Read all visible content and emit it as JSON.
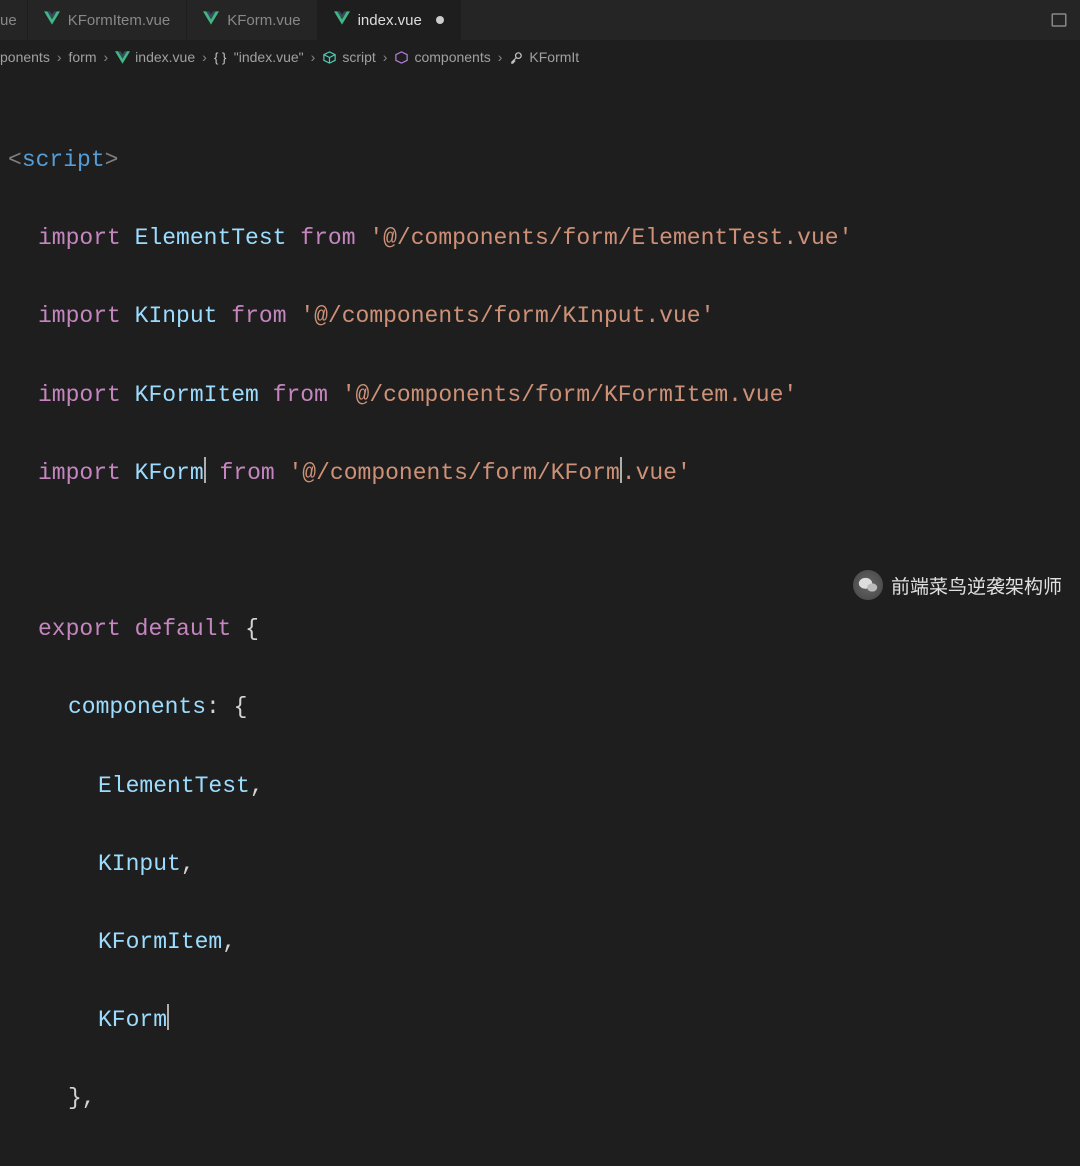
{
  "tabs": {
    "partial": "ue",
    "tab1": "KFormItem.vue",
    "tab2": "KForm.vue",
    "active": "index.vue"
  },
  "breadcrumb": {
    "crumb0_partial": "ponents",
    "crumb1": "form",
    "crumb2": "index.vue",
    "crumb3": "\"index.vue\"",
    "crumb4": "script",
    "crumb5": "components",
    "crumb6": "KFormIt"
  },
  "code": {
    "script_tag": "script",
    "lt": "<",
    "gt": ">",
    "import": "import",
    "export": "export",
    "default": "default",
    "from": "from",
    "components_key": "components",
    "id_ElementTest": "ElementTest",
    "id_KInput": "KInput",
    "id_KFormItem": "KFormItem",
    "id_KForm": "KForm",
    "path_ElementTest": "'@/components/form/ElementTest.vue'",
    "path_KInput": "'@/components/form/KInput.vue'",
    "path_KFormItem": "'@/components/form/KFormItem.vue'",
    "path_KForm_a": "'@/components/form/KForm",
    "path_KForm_b": ".vue'",
    "brace_open": "{",
    "brace_close": "}",
    "brace_close_comma": "},",
    "colon_brace": ": {",
    "comma": ","
  },
  "watermark": {
    "text": "前端菜鸟逆袭架构师"
  }
}
